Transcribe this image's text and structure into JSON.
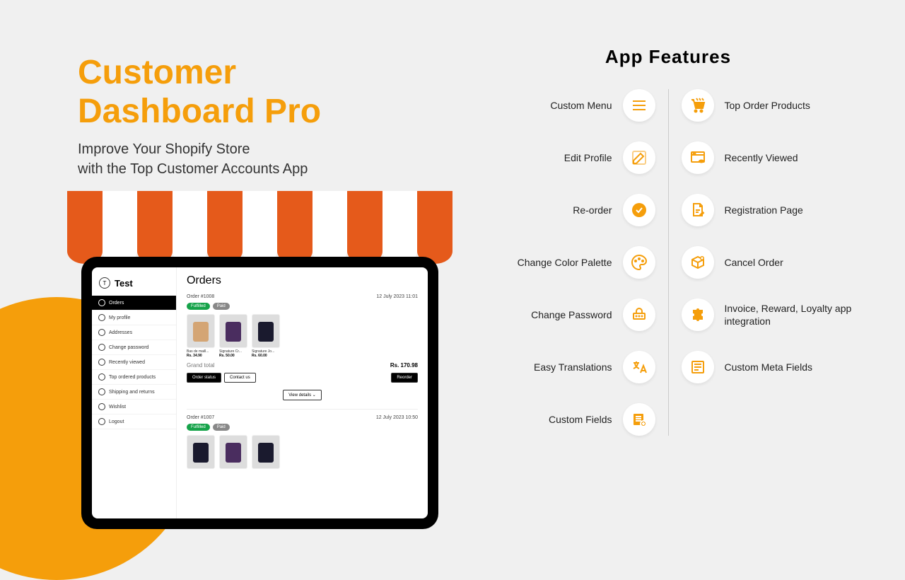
{
  "hero": {
    "title_line1": "Customer",
    "title_line2": "Dashboard Pro",
    "subtitle_line1": "Improve Your Shopify Store",
    "subtitle_line2": "with the Top Customer Accounts App"
  },
  "sidebar": {
    "avatar": "T",
    "name": "Test",
    "items": [
      {
        "label": "Orders",
        "active": true
      },
      {
        "label": "My profile"
      },
      {
        "label": "Addresses"
      },
      {
        "label": "Change password"
      },
      {
        "label": "Recently viewed"
      },
      {
        "label": "Top ordered products"
      },
      {
        "label": "Shipping and returns"
      },
      {
        "label": "Wishlist"
      },
      {
        "label": "Logout"
      }
    ]
  },
  "content": {
    "title": "Orders",
    "orders": [
      {
        "number": "Order #1008",
        "date": "12 July 2023 11:01",
        "badges": [
          "Fulfilled",
          "Paid"
        ],
        "products": [
          {
            "name": "Bas de maill...",
            "price": "Rs. 34.90"
          },
          {
            "name": "Signature Cr...",
            "price": "Rs. 50.00"
          },
          {
            "name": "Signature Jo...",
            "price": "Rs. 60.00"
          }
        ],
        "total_label": "Grand total",
        "total": "Rs. 170.98",
        "actions": {
          "status": "Order status",
          "contact": "Contact us",
          "reorder": "Reorder",
          "details": "View details ⌄"
        }
      },
      {
        "number": "Order #1007",
        "date": "12 July 2023 10:50",
        "badges": [
          "Fulfilled",
          "Paid"
        ]
      }
    ]
  },
  "features": {
    "title": "App Features",
    "left": [
      "Custom Menu",
      "Edit Profile",
      "Re-order",
      "Change Color Palette",
      "Change Password",
      "Easy Translations",
      "Custom Fields"
    ],
    "right": [
      "Top Order Products",
      "Recently Viewed",
      "Registration Page",
      "Cancel Order",
      "Invoice, Reward, Loyalty app integration",
      "Custom Meta Fields"
    ]
  }
}
